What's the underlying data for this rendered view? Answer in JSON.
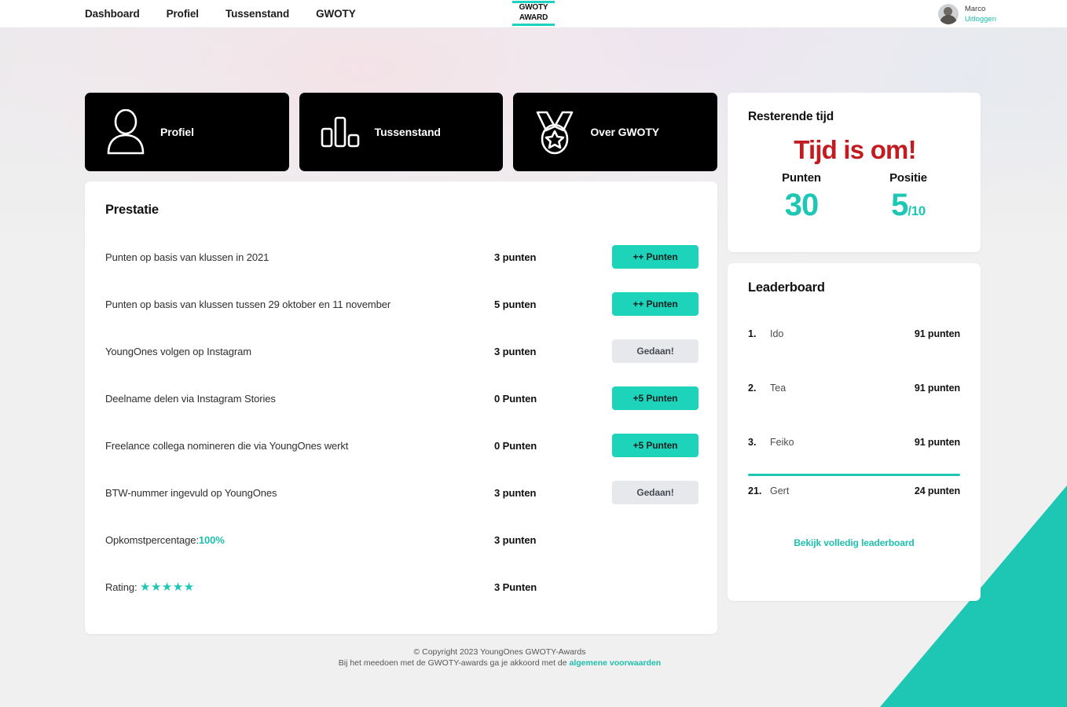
{
  "nav": {
    "links": [
      {
        "label": "Dashboard"
      },
      {
        "label": "Profiel"
      },
      {
        "label": "Tussenstand"
      },
      {
        "label": "GWOTY"
      }
    ],
    "logo": {
      "line1": "GWOTY",
      "line2": "AWARD"
    },
    "user": {
      "name": "Marco",
      "logout": "Uitloggen"
    }
  },
  "shortcuts": [
    {
      "label": "Profiel",
      "icon": "user-icon"
    },
    {
      "label": "Tussenstand",
      "icon": "bar-chart-icon"
    },
    {
      "label": "Over GWOTY",
      "icon": "medal-star-icon"
    }
  ],
  "prestatie": {
    "title": "Prestatie",
    "rows": [
      {
        "label": "Punten op basis van klussen in 2021",
        "points": "3 punten",
        "action": "++ Punten",
        "state": "active"
      },
      {
        "label": "Punten op basis van klussen tussen 29 oktober en 11 november",
        "points": "5 punten",
        "action": "++ Punten",
        "state": "active"
      },
      {
        "label": "YoungOnes volgen op Instagram",
        "points": "3 punten",
        "action": "Gedaan!",
        "state": "done"
      },
      {
        "label": "Deelname delen via Instagram Stories",
        "points": "0 Punten",
        "action": "+5 Punten",
        "state": "active"
      },
      {
        "label": "Freelance collega nomineren die via YoungOnes werkt",
        "points": "0 Punten",
        "action": "+5 Punten",
        "state": "active"
      },
      {
        "label": "BTW-nummer ingevuld op YoungOnes",
        "points": "3 punten",
        "action": "Gedaan!",
        "state": "done"
      },
      {
        "label": "Opkomstpercentage:",
        "value": "100%",
        "points": "3 punten",
        "state": "none"
      },
      {
        "label": "Rating:",
        "stars": "★★★★★",
        "points": "3 Punten",
        "state": "none"
      }
    ]
  },
  "timecard": {
    "heading": "Resterende tijd",
    "status": "Tijd is om!",
    "points_label": "Punten",
    "points_value": "30",
    "position_label": "Positie",
    "position_value": "5",
    "position_denom": "/10"
  },
  "leaderboard": {
    "heading": "Leaderboard",
    "rows": [
      {
        "rank": "1.",
        "name": "Ido",
        "points": "91 punten"
      },
      {
        "rank": "2.",
        "name": "Tea",
        "points": "91 punten"
      },
      {
        "rank": "3.",
        "name": "Feiko",
        "points": "91 punten"
      }
    ],
    "self": {
      "rank": "21.",
      "name": "Gert",
      "points": "24 punten"
    },
    "link": "Bekijk volledig leaderboard"
  },
  "footer": {
    "line1": "© Copyright 2023 YoungOnes GWOTY-Awards",
    "line2_prefix": "Bij het meedoen met de GWOTY-awards ga je akkoord met de ",
    "line2_link": "algemene voorwaarden"
  },
  "colors": {
    "accent_teal": "#1dc7b4",
    "button_teal": "#1dd3b9",
    "alert_red": "#c21c21",
    "card_black": "#000000",
    "page_bg": "#f0f0f0"
  }
}
